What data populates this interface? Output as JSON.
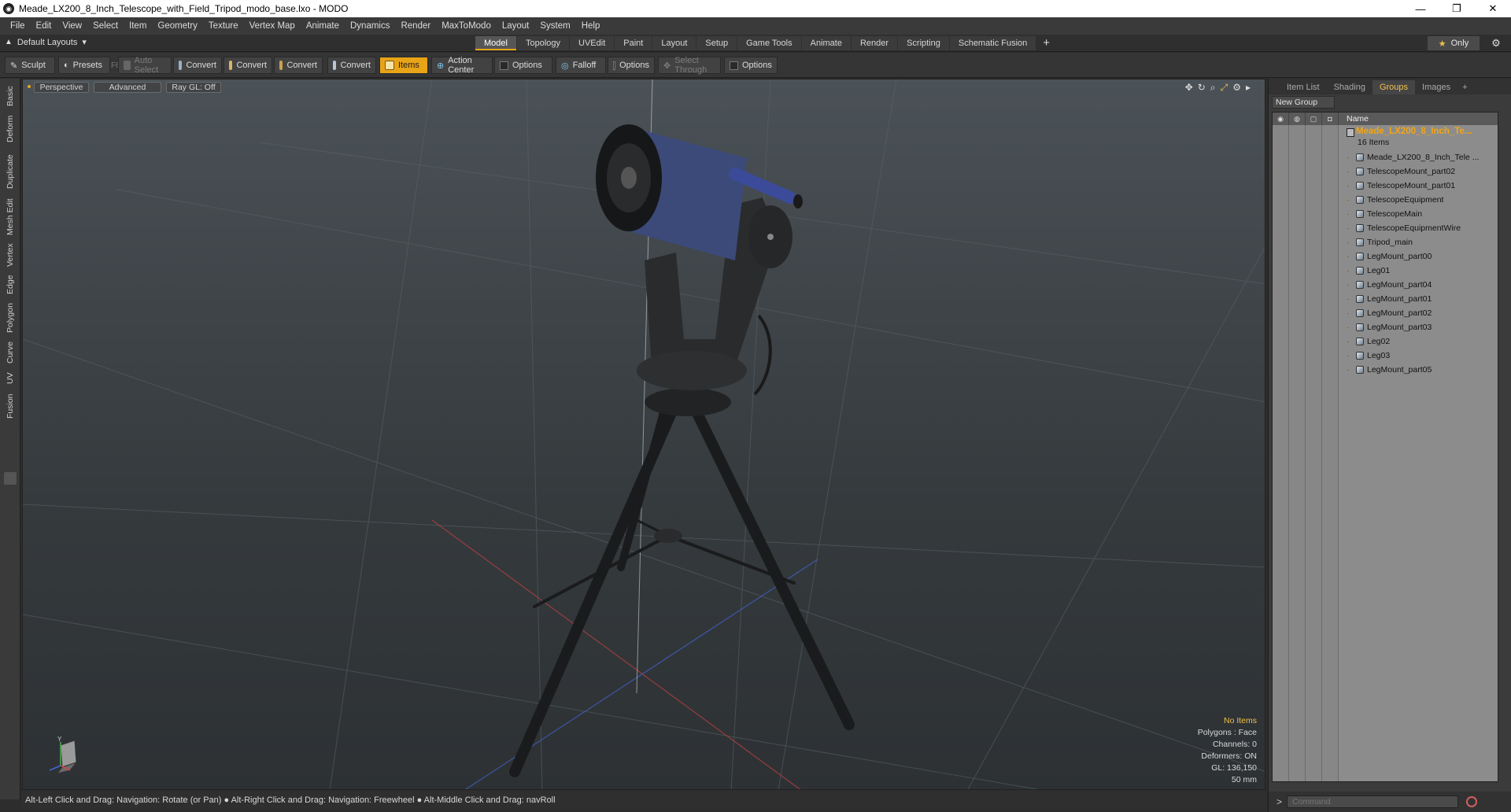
{
  "window": {
    "title": "Meade_LX200_8_Inch_Telescope_with_Field_Tripod_modo_base.lxo - MODO",
    "minimize": "—",
    "maximize": "❐",
    "close": "✕"
  },
  "menu": [
    "File",
    "Edit",
    "View",
    "Select",
    "Item",
    "Geometry",
    "Texture",
    "Vertex Map",
    "Animate",
    "Dynamics",
    "Render",
    "MaxToModo",
    "Layout",
    "System",
    "Help"
  ],
  "layouts": {
    "label": "Default Layouts",
    "arrow": "▾"
  },
  "tabs": [
    "Model",
    "Topology",
    "UVEdit",
    "Paint",
    "Layout",
    "Setup",
    "Game Tools",
    "Animate",
    "Render",
    "Scripting",
    "Schematic Fusion"
  ],
  "tabs_active": "Model",
  "tab_add": "+",
  "only_button": {
    "star": "★",
    "label": "Only"
  },
  "toolbar": {
    "sculpt": "Sculpt",
    "presets": "Presets",
    "presets_key": "F6",
    "auto_select": "Auto Select",
    "convert1": "Convert",
    "convert2": "Convert",
    "convert3": "Convert",
    "convert4": "Convert",
    "items": "Items",
    "action_center": "Action Center",
    "options1": "Options",
    "falloff": "Falloff",
    "options2": "Options",
    "select_through": "Select Through",
    "options3": "Options"
  },
  "left_palette": [
    "Basic",
    "Deform",
    "Duplicate",
    "Mesh Edit",
    "Vertex",
    "Edge",
    "Polygon",
    "Curve",
    "UV",
    "Fusion"
  ],
  "viewport": {
    "view_mode": "Perspective",
    "shading": "Advanced",
    "raygl": "Ray GL: Off",
    "stats": {
      "selection": "No Items",
      "polygons": "Polygons : Face",
      "channels": "Channels: 0",
      "deformers": "Deformers: ON",
      "gl": "GL: 136,150",
      "lens": "50 mm"
    },
    "gizmo_label": "Y"
  },
  "status": "Alt-Left Click and Drag: Navigation: Rotate (or Pan) ● Alt-Right Click and Drag: Navigation: Freewheel ● Alt-Middle Click and Drag: navRoll",
  "right_panel": {
    "tabs": [
      "Item List",
      "Shading",
      "Groups",
      "Images"
    ],
    "active_tab": "Groups",
    "add": "+",
    "new_group": "New Group",
    "name_header": "Name",
    "group_name": "Meade_LX200_8_Inch_Te...",
    "group_count": "16 Items",
    "items": [
      "Meade_LX200_8_Inch_Tele ...",
      "TelescopeMount_part02",
      "TelescopeMount_part01",
      "TelescopeEquipment",
      "TelescopeMain",
      "TelescopeEquipmentWire",
      "Tripod_main",
      "LegMount_part00",
      "Leg01",
      "LegMount_part04",
      "LegMount_part01",
      "LegMount_part02",
      "LegMount_part03",
      "Leg02",
      "Leg03",
      "LegMount_part05"
    ],
    "command_prompt": ">",
    "command_placeholder": "Command"
  },
  "colors": {
    "accent": "#e8a317",
    "group_name": "#f2a516",
    "viewport_top": "#4b5257",
    "viewport_bottom": "#2d3134"
  }
}
